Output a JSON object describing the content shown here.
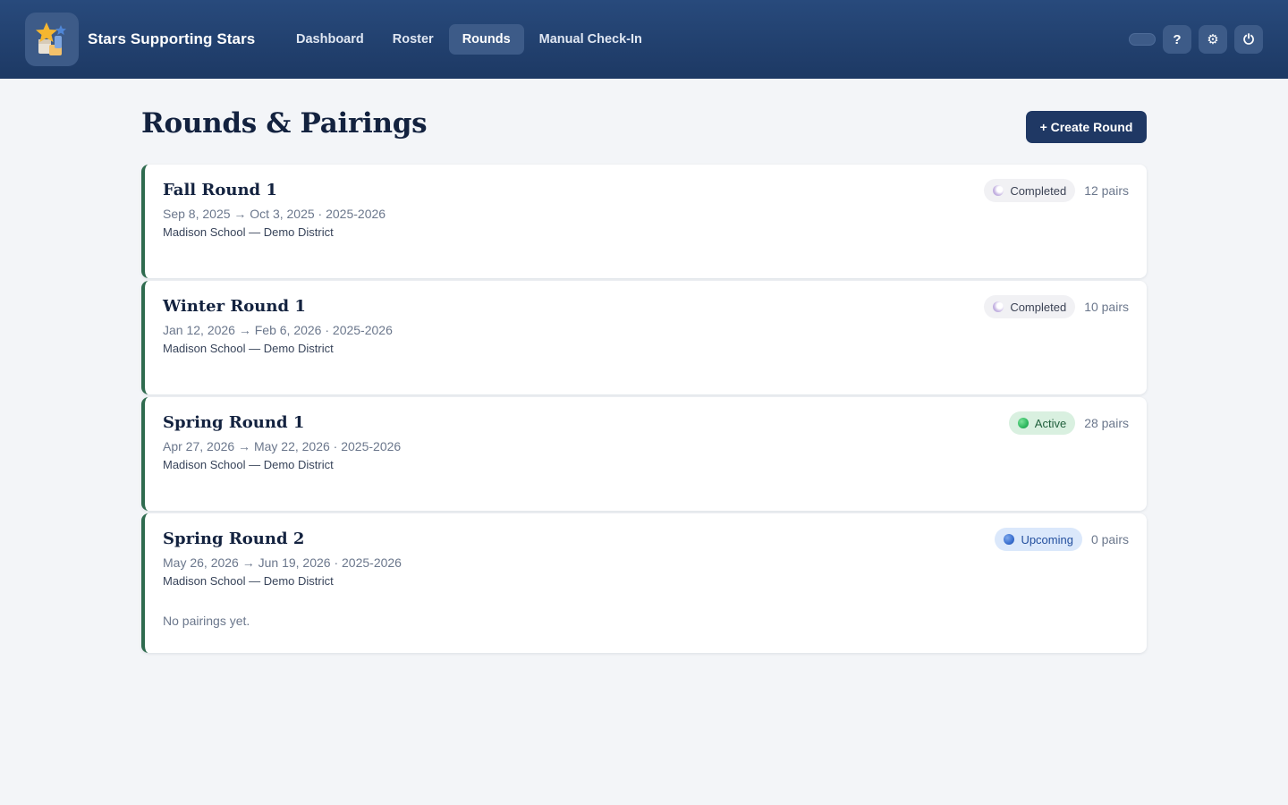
{
  "header": {
    "brand": "Stars Supporting Stars",
    "nav": [
      {
        "label": "Dashboard",
        "active": false
      },
      {
        "label": "Roster",
        "active": false
      },
      {
        "label": "Rounds",
        "active": true
      },
      {
        "label": "Manual Check-In",
        "active": false
      }
    ],
    "help_label": "?",
    "settings_label": "⚙",
    "power_label": "⏻"
  },
  "main": {
    "title": "Rounds & Pairings",
    "create_button": "+ Create Round",
    "rounds": [
      {
        "name": "Fall Round 1",
        "dates": "Sep 8, 2025 → Oct 3, 2025 · 2025-2026",
        "school": "Madison School — Demo District",
        "status": "Completed",
        "pairs": "12 pairs"
      },
      {
        "name": "Winter Round 1",
        "dates": "Jan 12, 2026 → Feb 6, 2026 · 2025-2026",
        "school": "Madison School — Demo District",
        "status": "Completed",
        "pairs": "10 pairs"
      },
      {
        "name": "Spring Round 1",
        "dates": "Apr 27, 2026 → May 22, 2026 · 2025-2026",
        "school": "Madison School — Demo District",
        "status": "Active",
        "pairs": "28 pairs"
      },
      {
        "name": "Spring Round 2",
        "dates": "May 26, 2026 → Jun 19, 2026 · 2025-2026",
        "school": "Madison School — Demo District",
        "status": "Upcoming",
        "pairs": "0 pairs",
        "empty_message": "No pairings yet."
      }
    ]
  },
  "colors": {
    "header": "#1f3864",
    "card_accent": "#2f6b4f",
    "active_badge": "#d9f0e0",
    "upcoming_badge": "#dbe8fb",
    "completed_badge": "#f1f1f4"
  }
}
